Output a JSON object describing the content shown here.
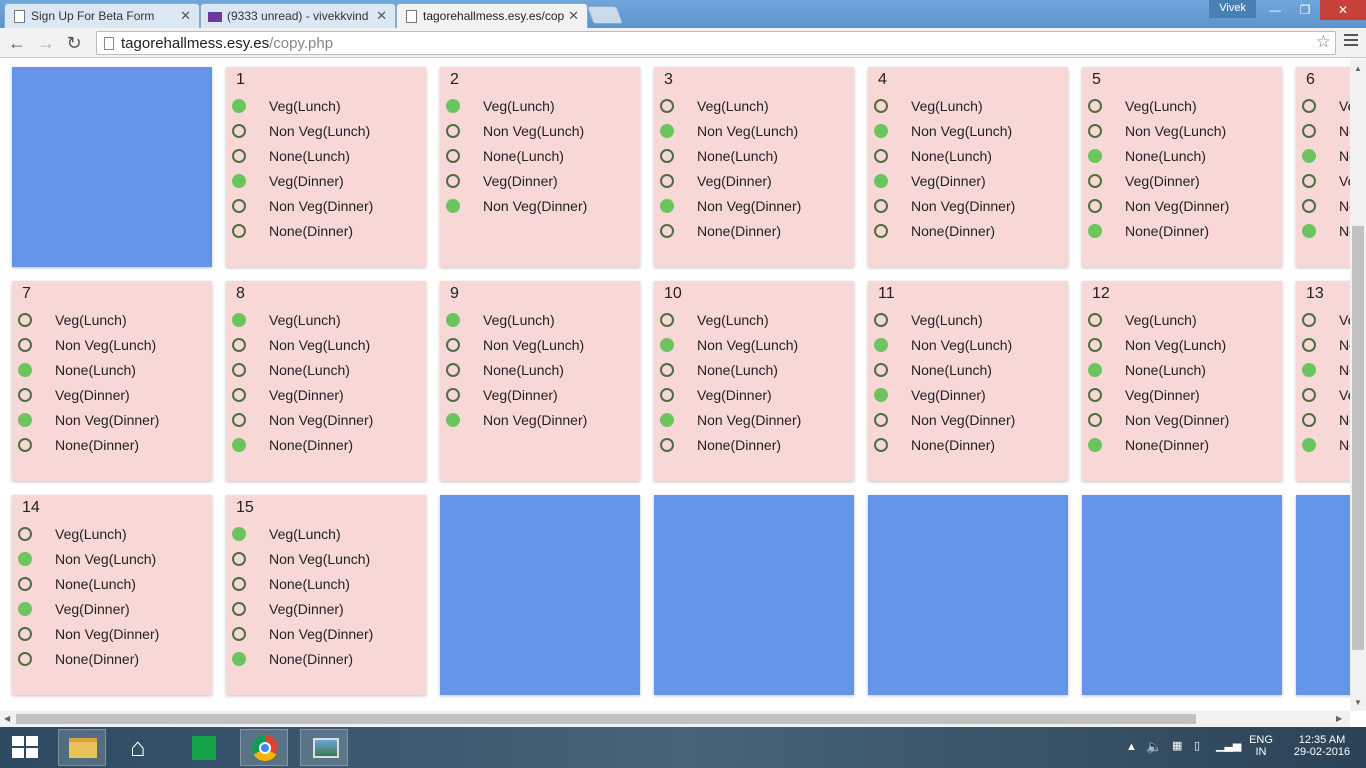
{
  "browser": {
    "tabs": [
      {
        "title": "Sign Up For Beta Form",
        "icon": "document-icon"
      },
      {
        "title": "(9333 unread) - vivekkvind",
        "icon": "mail-icon"
      },
      {
        "title": "tagorehallmess.esy.es/cop",
        "icon": "document-icon"
      }
    ],
    "user": "Vivek",
    "url_domain": "tagorehallmess.esy.es",
    "url_path": "/copy.php"
  },
  "labels": {
    "veg_lunch": "Veg(Lunch)",
    "nonveg_lunch": "Non Veg(Lunch)",
    "none_lunch": "None(Lunch)",
    "veg_dinner": "Veg(Dinner)",
    "nonveg_dinner": "Non Veg(Dinner)",
    "none_dinner": "None(Dinner)"
  },
  "days": [
    {
      "day": "1",
      "selected": [
        "veg_lunch",
        "veg_dinner"
      ],
      "options": 6
    },
    {
      "day": "2",
      "selected": [
        "veg_lunch",
        "nonveg_dinner"
      ],
      "options": 5
    },
    {
      "day": "3",
      "selected": [
        "nonveg_lunch",
        "nonveg_dinner"
      ],
      "options": 6
    },
    {
      "day": "4",
      "selected": [
        "nonveg_lunch",
        "veg_dinner"
      ],
      "options": 6
    },
    {
      "day": "5",
      "selected": [
        "none_lunch",
        "none_dinner"
      ],
      "options": 6
    },
    {
      "day": "6",
      "selected": [
        "none_lunch",
        "none_dinner"
      ],
      "options": 6
    },
    {
      "day": "7",
      "selected": [
        "none_lunch",
        "nonveg_dinner"
      ],
      "options": 6
    },
    {
      "day": "8",
      "selected": [
        "veg_lunch",
        "none_dinner"
      ],
      "options": 6
    },
    {
      "day": "9",
      "selected": [
        "veg_lunch",
        "nonveg_dinner"
      ],
      "options": 5
    },
    {
      "day": "10",
      "selected": [
        "nonveg_lunch",
        "nonveg_dinner"
      ],
      "options": 6
    },
    {
      "day": "11",
      "selected": [
        "nonveg_lunch",
        "veg_dinner"
      ],
      "options": 6
    },
    {
      "day": "12",
      "selected": [
        "none_lunch",
        "none_dinner"
      ],
      "options": 6
    },
    {
      "day": "13",
      "selected": [
        "none_lunch",
        "none_dinner"
      ],
      "options": 6
    },
    {
      "day": "14",
      "selected": [
        "nonveg_lunch",
        "veg_dinner"
      ],
      "options": 6
    },
    {
      "day": "15",
      "selected": [
        "veg_lunch",
        "none_dinner"
      ],
      "options": 6
    }
  ],
  "taskbar": {
    "language": "ENG",
    "region": "IN",
    "time": "12:35 AM",
    "date": "29-02-2016"
  }
}
